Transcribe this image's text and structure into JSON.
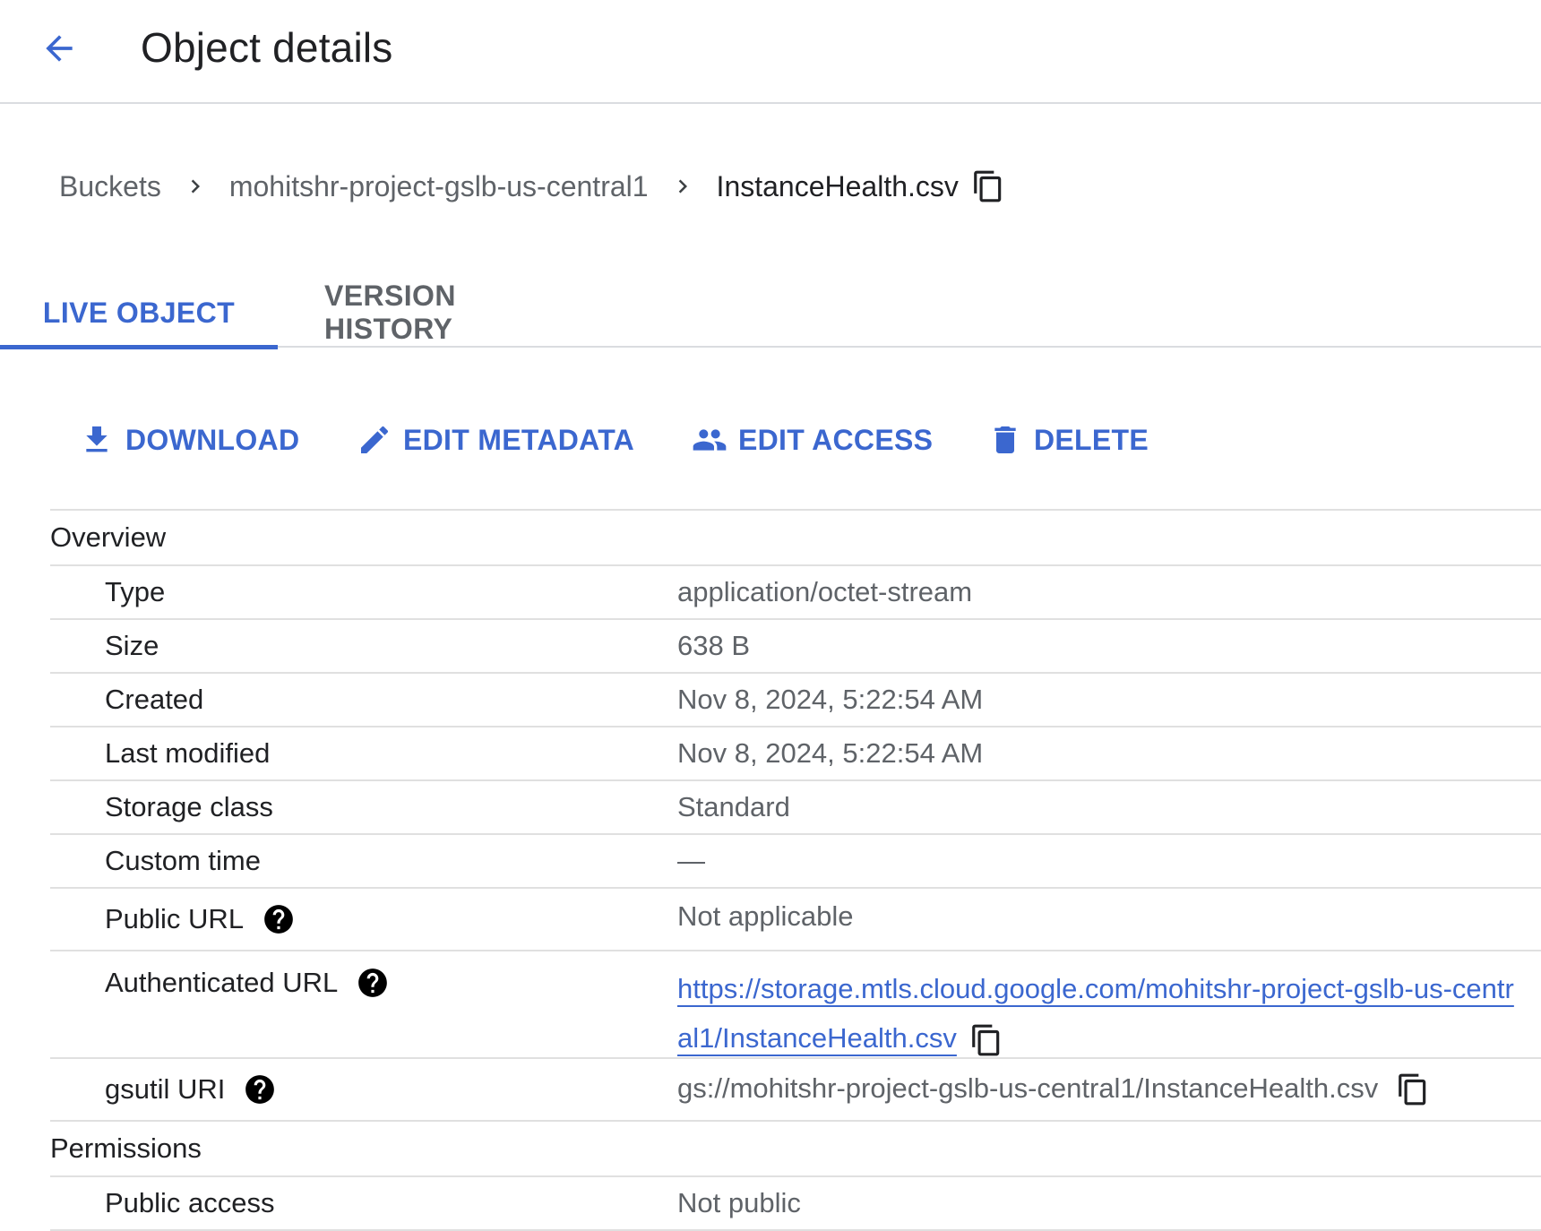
{
  "header": {
    "back_icon": "arrow-back-icon",
    "title": "Object details"
  },
  "breadcrumb": {
    "items": [
      "Buckets",
      "mohitshr-project-gslb-us-central1",
      "InstanceHealth.csv"
    ],
    "separator_icon": "chevron-right-icon",
    "copy_icon": "copy-icon"
  },
  "tabs": [
    {
      "label": "LIVE OBJECT",
      "active": true
    },
    {
      "label": "VERSION HISTORY",
      "active": false
    }
  ],
  "actions": [
    {
      "label": "DOWNLOAD",
      "icon": "download-icon"
    },
    {
      "label": "EDIT METADATA",
      "icon": "pencil-icon"
    },
    {
      "label": "EDIT ACCESS",
      "icon": "people-icon"
    },
    {
      "label": "DELETE",
      "icon": "trash-icon"
    }
  ],
  "overview": {
    "title": "Overview",
    "rows": [
      {
        "label": "Type",
        "value": "application/octet-stream"
      },
      {
        "label": "Size",
        "value": "638 B"
      },
      {
        "label": "Created",
        "value": "Nov 8, 2024, 5:22:54 AM"
      },
      {
        "label": "Last modified",
        "value": "Nov 8, 2024, 5:22:54 AM"
      },
      {
        "label": "Storage class",
        "value": "Standard"
      },
      {
        "label": "Custom time",
        "value": "—"
      },
      {
        "label": "Public URL",
        "value": "Not applicable",
        "help_icon": "help-icon"
      },
      {
        "label": "Authenticated URL",
        "value": "https://storage.mtls.cloud.google.com/mohitshr-project-gslb-us-central1/InstanceHealth.csv",
        "help_icon": "help-icon",
        "copy_icon": "copy-icon"
      },
      {
        "label": "gsutil URI",
        "value": "gs://mohitshr-project-gslb-us-central1/InstanceHealth.csv",
        "help_icon": "help-icon",
        "copy_icon": "copy-icon"
      }
    ]
  },
  "permissions": {
    "title": "Permissions",
    "rows": [
      {
        "label": "Public access",
        "value": "Not public"
      }
    ]
  },
  "colors": {
    "accent": "#3b67cf",
    "text_primary": "#202124",
    "text_secondary": "#5f6368",
    "divider": "#e0e0e0"
  }
}
